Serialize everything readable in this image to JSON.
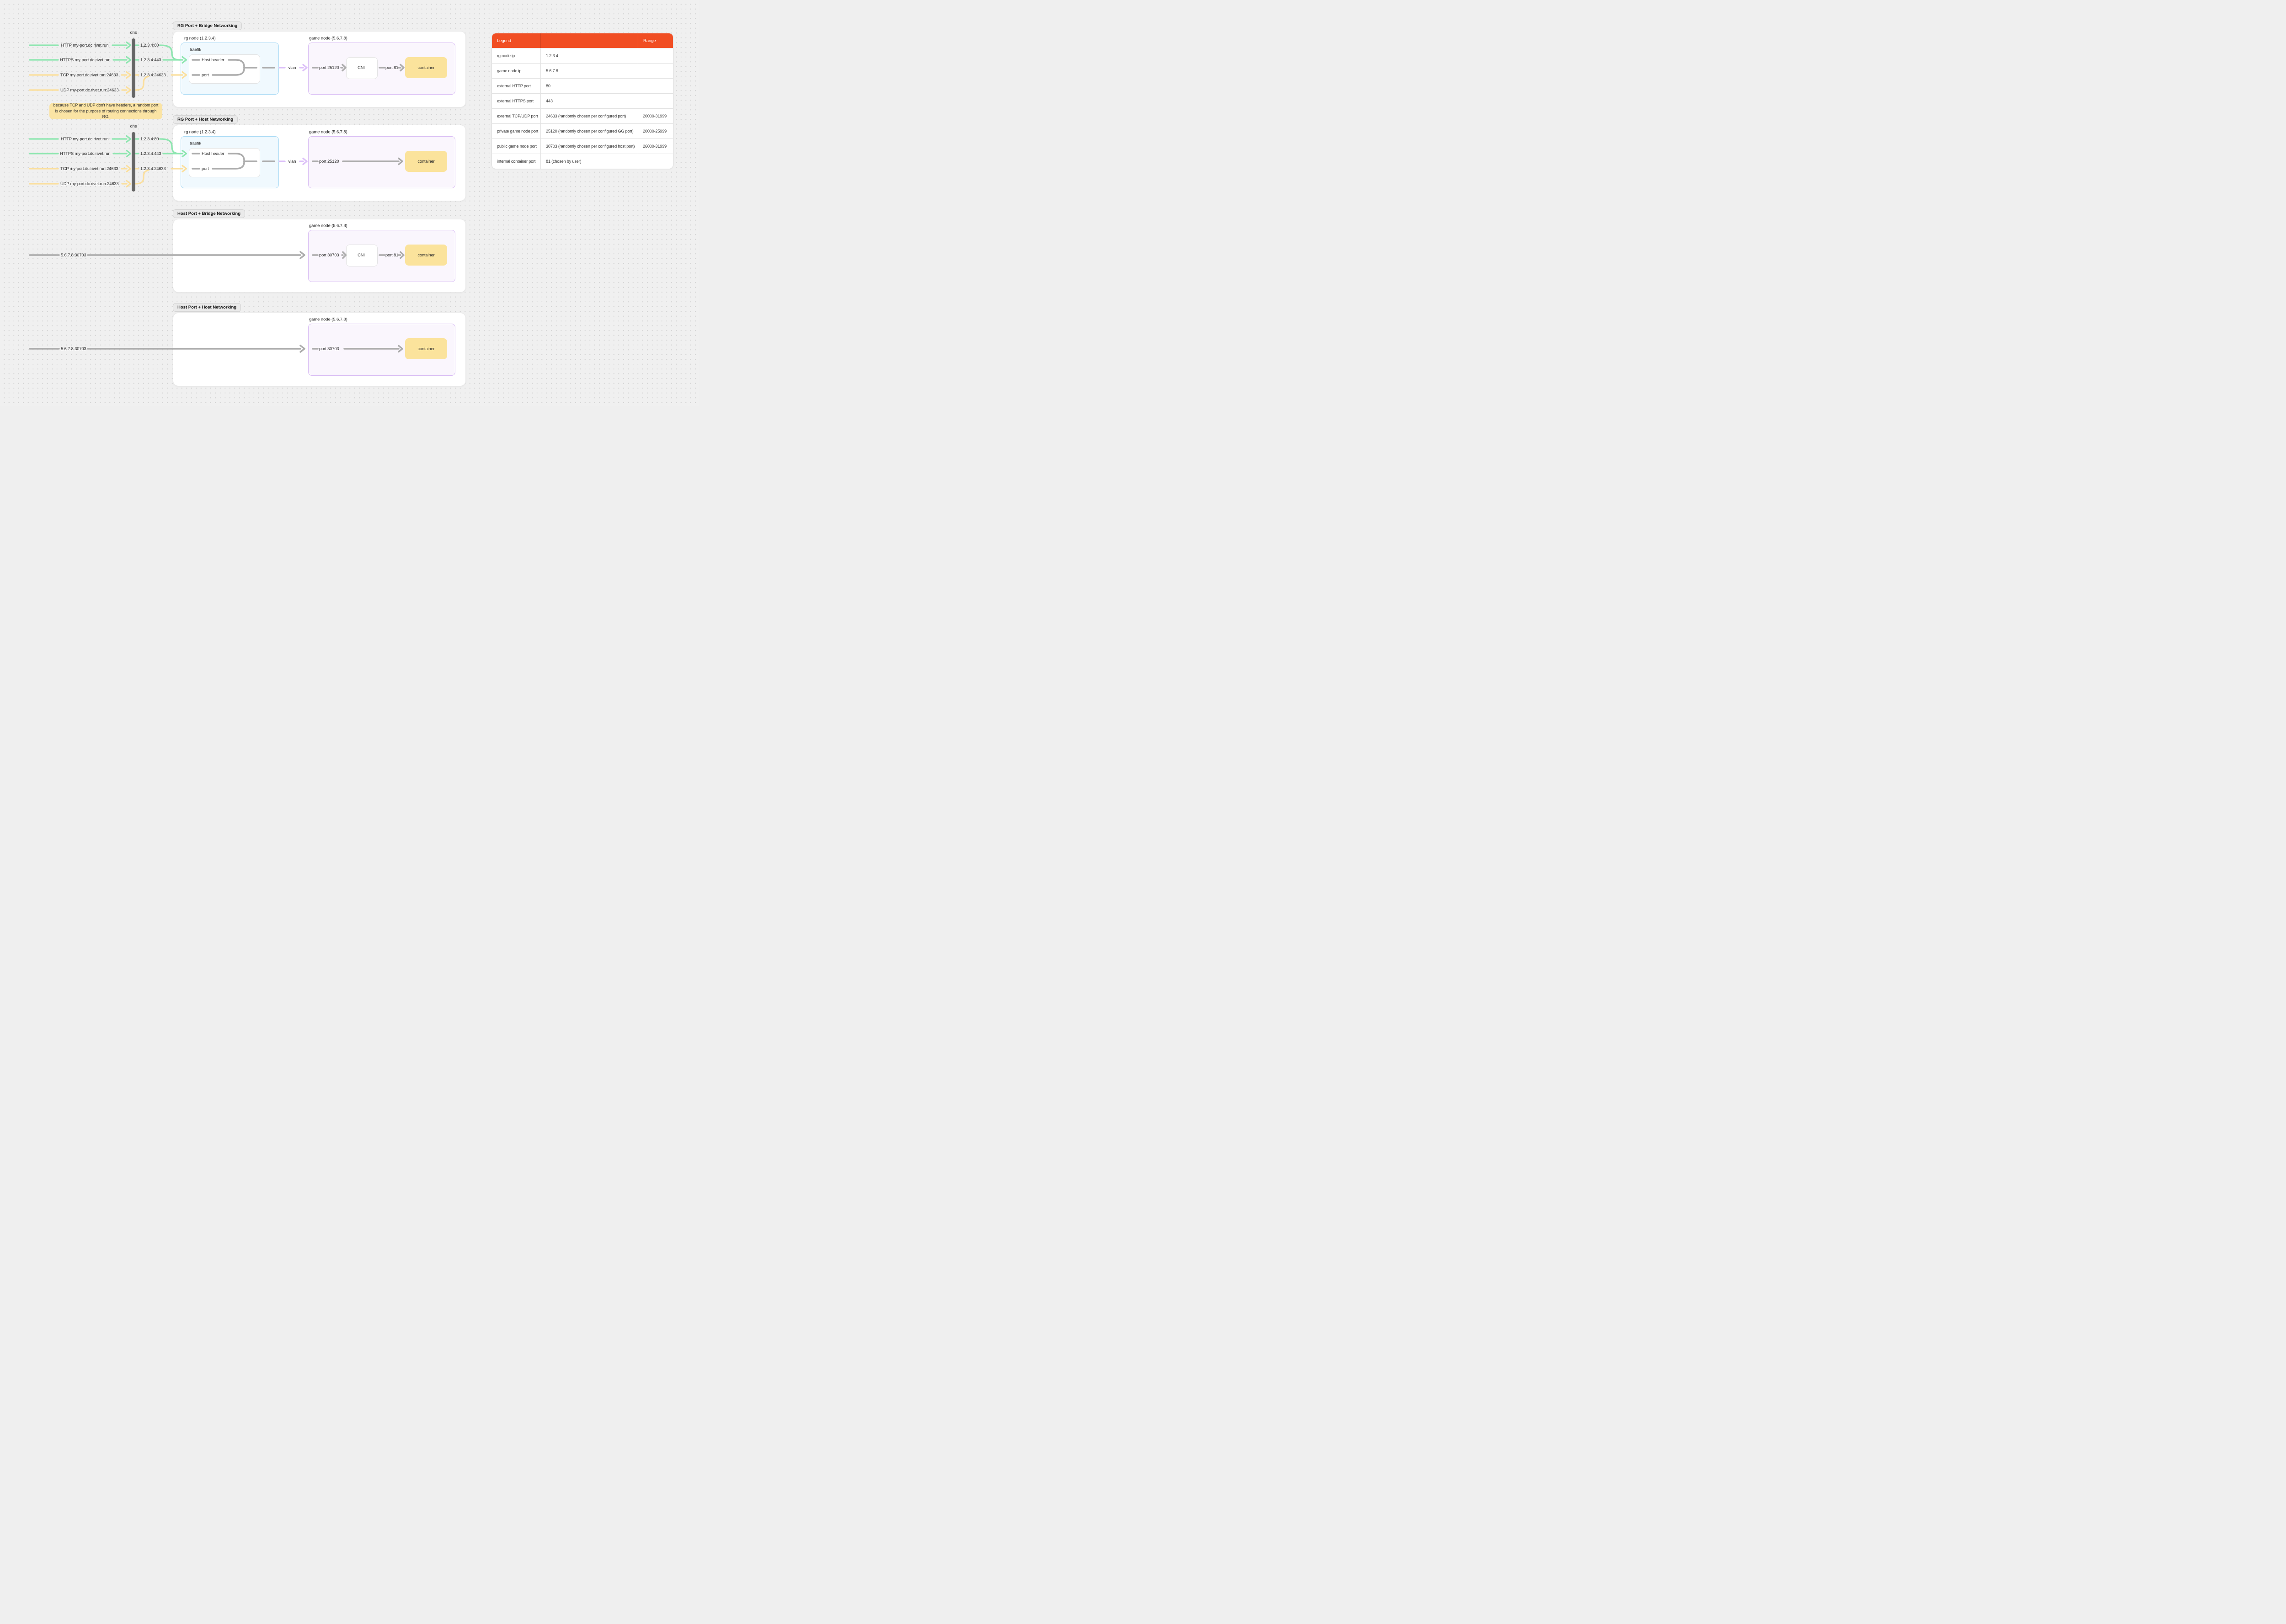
{
  "dns": {
    "label": "dns"
  },
  "flows": {
    "http": {
      "label": "HTTP my-port.dc.rivet.run",
      "resolved": "1.2.3.4:80"
    },
    "https": {
      "label": "HTTPS my-port.dc.rivet.run",
      "resolved": "1.2.3.4:443"
    },
    "tcp": {
      "label": "TCP my-port.dc.rivet.run:24633",
      "resolved": "1.2.3.4:24633"
    },
    "udp": {
      "label": "UDP my-port.dc.rivet.run:24633"
    }
  },
  "note": {
    "text": "because TCP and UDP don't have headers, a random port is chosen for the purpose of routing connections through RG."
  },
  "nodes": {
    "rg_node": "rg node (1.2.3.4)",
    "game_node": "game node (5.6.7.8)",
    "traefik": "traefik",
    "host_header": "Host header",
    "port": "port",
    "vlan": "vlan",
    "cni": "CNI",
    "container": "container",
    "rg_port": "port 25120",
    "host_port": "port 30703",
    "internal_port": "port 81",
    "host_source": "5.6.7.8:30703"
  },
  "sections": [
    {
      "title": "RG Port + Bridge Networking"
    },
    {
      "title": "RG Port + Host Networking"
    },
    {
      "title": "Host Port + Bridge Networking"
    },
    {
      "title": "Host Port + Host Networking"
    }
  ],
  "legend": {
    "header": {
      "legend": "Legend",
      "middle": "",
      "range": "Range"
    },
    "rows": [
      {
        "name": "rg node ip",
        "value": "1.2.3.4",
        "range": ""
      },
      {
        "name": "game node ip",
        "value": "5.6.7.8",
        "range": ""
      },
      {
        "name": "external HTTP port",
        "value": "80",
        "range": ""
      },
      {
        "name": "external HTTPS port",
        "value": "443",
        "range": ""
      },
      {
        "name": "external TCP/UDP port",
        "value": "24633 (randomly chosen per configured port)",
        "range": "20000-31999"
      },
      {
        "name": "private game node port",
        "value": "25120 (randomly chosen per configured GG port)",
        "range": "20000-25999"
      },
      {
        "name": "public game node port",
        "value": "30703 (randomly chosen per configured host port)",
        "range": "26000-31999"
      },
      {
        "name": "internal container port",
        "value": "81 (chosen by user)",
        "range": ""
      }
    ]
  },
  "colors": {
    "table_header": "#F14E23",
    "green_connector": "#8EE6B0",
    "yellow_connector": "#FBDF9D",
    "purple_connector": "#DCC0F8",
    "gray_connector": "#ACACAC",
    "dns_bar": "#656565",
    "container_fill": "#FBE39C",
    "note_fill": "#FBE4A4",
    "rg_node_fill": "#F0F9FE",
    "rg_node_border": "#A9DAF5",
    "game_node_fill": "#FAF6FD",
    "game_node_border": "#D9BDF4"
  }
}
